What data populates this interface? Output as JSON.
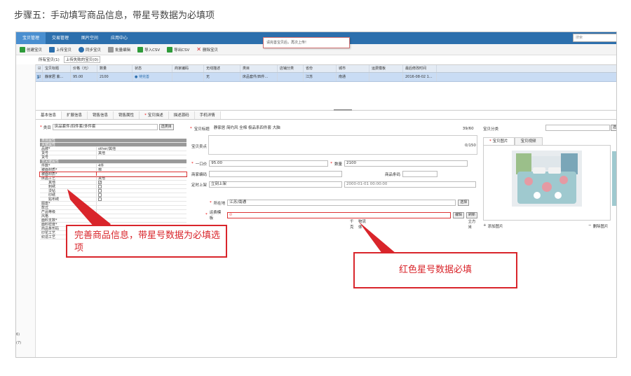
{
  "page": {
    "step_title": "步骤五：手动填写商品信息，带星号数据为必填项"
  },
  "menubar": {
    "items": [
      "宝贝管理",
      "交易管理",
      "图片空间",
      "应用中心"
    ],
    "search_placeholder": "搜索"
  },
  "toolbar": {
    "buttons": [
      {
        "label": "创建宝贝",
        "icon": "plus-icon",
        "color": "#2e9b3a"
      },
      {
        "label": "上传宝贝",
        "icon": "upload-icon",
        "color": "#2c6fad"
      },
      {
        "label": "同步宝贝",
        "icon": "sync-icon",
        "color": "#2c6fad"
      },
      {
        "label": "批量编辑",
        "icon": "edit-icon",
        "color": "#888888"
      },
      {
        "label": "导入CSV",
        "icon": "import-icon",
        "color": "#2e9b3a"
      },
      {
        "label": "导出CSV",
        "icon": "export-icon",
        "color": "#2e9b3a"
      },
      {
        "label": "删除宝贝",
        "icon": "delete-icon",
        "color": "#d9252b"
      }
    ],
    "tooltip": "请完善宝贝后，再次上传!"
  },
  "tabs_row": {
    "all_label": "所有宝贝(1)",
    "box_label": "上传失败的宝贝(0)"
  },
  "grid": {
    "headers": [
      "宝贝标题",
      "价格（元）",
      "数量",
      "状态",
      "商家编码",
      "无线描述",
      "类目",
      "店铺分类",
      "省份",
      "城市",
      "运费模板",
      "最后修改时间"
    ],
    "row": {
      "num": "1",
      "title": "静家居 紫...",
      "price": "95.00",
      "qty": "2100",
      "status": "待完善",
      "code": "",
      "wireless": "无",
      "category": "床品套件/四件...",
      "shop_cat": "",
      "province": "江苏",
      "city": "南通",
      "freight": "",
      "modified": "2016-08-02 1..."
    }
  },
  "left_strip": {
    "labels": [
      "6)",
      "(7)"
    ]
  },
  "detail_tabs": [
    "基本信息",
    "扩展信息",
    "销售信息",
    "销售属性",
    "宝贝描述",
    "描述源码",
    "手机详情"
  ],
  "category": {
    "label": "类目",
    "value": "床品套件/四件套/多件套",
    "button": "选类目"
  },
  "props": {
    "rows": [
      {
        "k": "类目属性",
        "v": "",
        "type": "sec"
      },
      {
        "k": "关键属性",
        "v": "",
        "type": "sec"
      },
      {
        "k": "品牌*",
        "v": "other/其他",
        "type": "row"
      },
      {
        "k": "货号",
        "v": "其他",
        "type": "row"
      },
      {
        "k": "货号",
        "v": "",
        "type": "row"
      },
      {
        "k": "非关键属性",
        "v": "",
        "type": "sec"
      },
      {
        "k": "件数*",
        "v": "4件",
        "type": "row"
      },
      {
        "k": "被面材质*",
        "v": "棉",
        "type": "row"
      },
      {
        "k": "被面材质*",
        "v": "",
        "type": "hl"
      },
      {
        "k": "床品工艺",
        "v": "其他",
        "type": "row"
      },
      {
        "k": "其他",
        "v": "✓",
        "type": "chk"
      },
      {
        "k": "刺绣",
        "v": "",
        "type": "chk"
      },
      {
        "k": "烫钻",
        "v": "",
        "type": "chk"
      },
      {
        "k": "印绣",
        "v": "",
        "type": "chk"
      },
      {
        "k": "贴布绣",
        "v": "",
        "type": "chk"
      },
      {
        "k": "图案*",
        "v": "",
        "type": "row"
      },
      {
        "k": "款式",
        "v": "",
        "type": "row"
      },
      {
        "k": "产品等级",
        "v": "",
        "type": "row"
      },
      {
        "k": "风格",
        "v": "",
        "type": "row"
      },
      {
        "k": "面料支数*",
        "v": "",
        "type": "row"
      },
      {
        "k": "面料密度*",
        "v": "",
        "type": "row"
      },
      {
        "k": "商品条形码",
        "v": "",
        "type": "row"
      },
      {
        "k": "印花工艺",
        "v": "",
        "type": "row"
      },
      {
        "k": "织造工艺",
        "v": "",
        "type": "row"
      }
    ]
  },
  "form": {
    "title_label": "宝贝标题",
    "title_value": "静家居 简约风  全棉  极品系四件套 大脑",
    "title_count": "39/60",
    "selling_label": "宝贝卖点",
    "selling_count": "0/150",
    "price_label": "一口价",
    "price_value": "95.00",
    "qty_label": "数量",
    "qty_value": "2100",
    "code_label": "商家编码",
    "barcode_label": "商品条码",
    "timing_label": "定时上架",
    "timing_value": "立刻上架",
    "timing_date": "2000-01-01 00:00:00",
    "location_label": "所在地",
    "location_value": "江苏/南通",
    "location_btn": "选择",
    "freight_label": "运费模板",
    "freight_edit": "编辑",
    "freight_refresh": "刷新",
    "weight_label": "千克",
    "volume_label": "物流体",
    "volume_unit": "立方米"
  },
  "right_panel": {
    "cat_label": "宝贝分类",
    "cat_btn": "选",
    "pic_tabs": [
      "宝贝图片",
      "宝贝视频"
    ],
    "add_pic": "添加图片",
    "del_pic": "删除图片"
  },
  "callouts": {
    "left": "完善商品信息，带星号数据为必填选项",
    "right": "红色星号数据必填"
  },
  "colors": {
    "accent_red": "#d9252b",
    "menu_blue": "#2c6fad",
    "row_blue": "#c9dcf4"
  }
}
